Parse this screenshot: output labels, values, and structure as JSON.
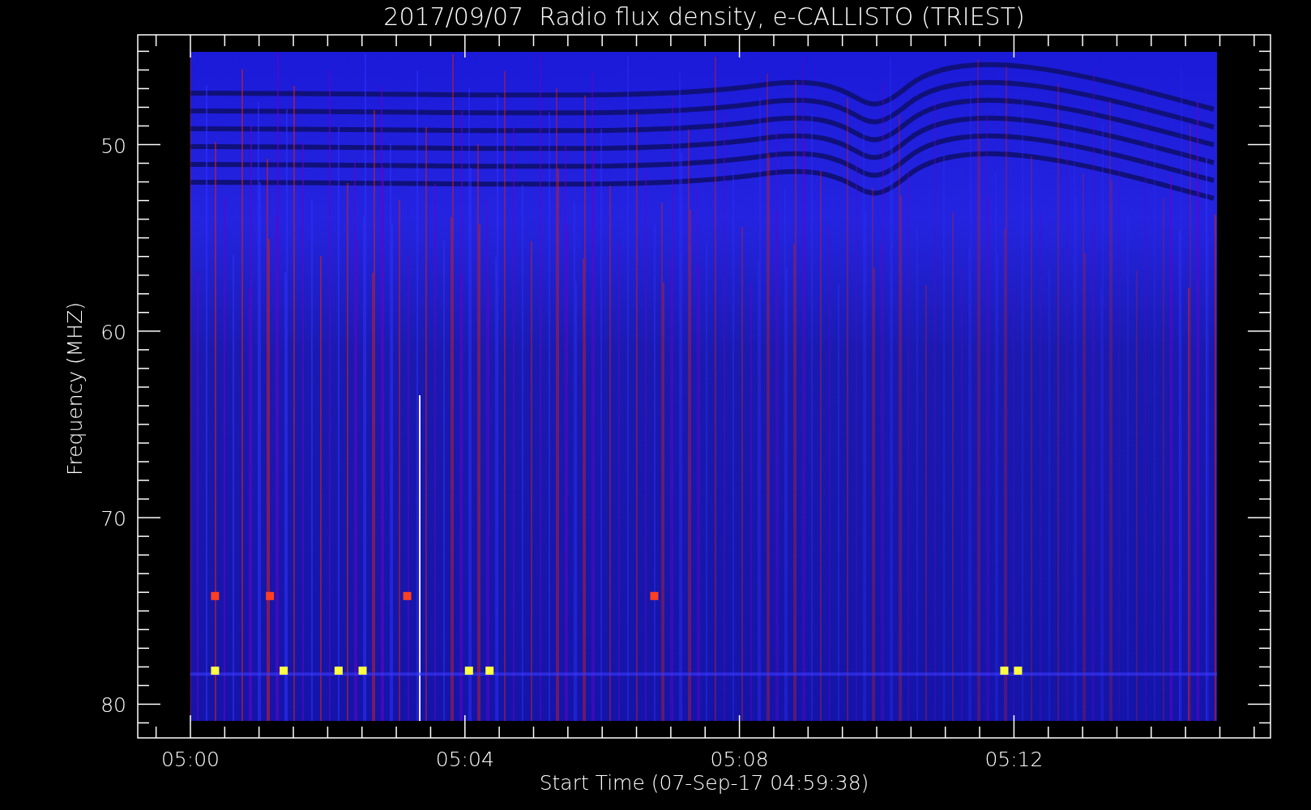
{
  "plot": {
    "title": "2017/09/07  Radio flux density, e-CALLISTO (TRIEST)",
    "y_axis": {
      "label": "Frequency (MHZ)",
      "ticks": [
        "50",
        "60",
        "70",
        "80"
      ]
    },
    "x_axis": {
      "label": "Start Time (07-Sep-17 04:59:38)",
      "ticks": [
        "05:00",
        "05:04",
        "05:08",
        "05:12"
      ]
    }
  }
}
